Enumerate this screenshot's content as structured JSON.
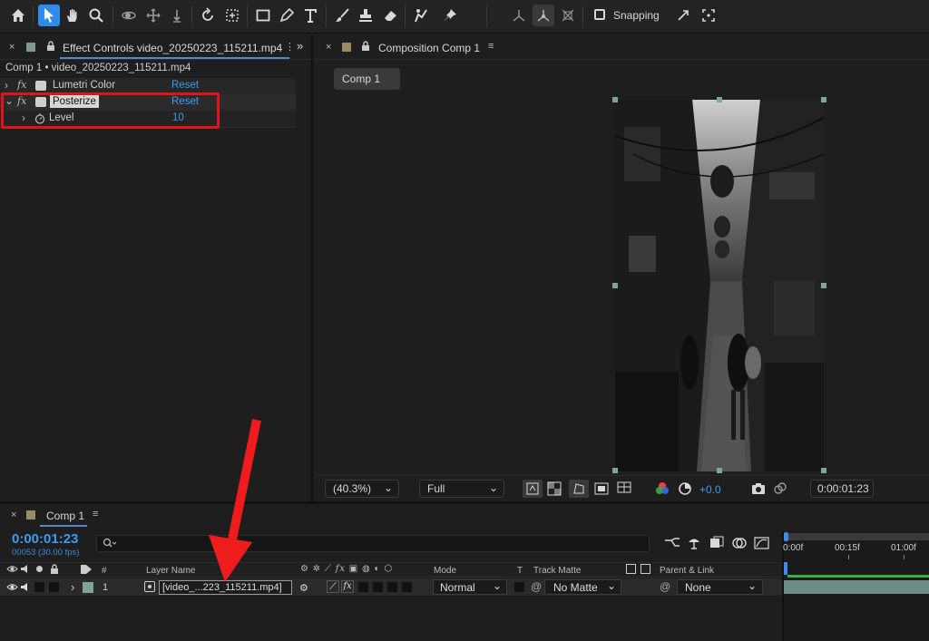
{
  "toolbar": {
    "snapping_label": "Snapping",
    "tools": [
      "home-icon",
      "selection-icon",
      "hand-icon",
      "zoom-icon",
      "orbit-icon",
      "pan-behind-icon",
      "dolly-icon",
      "rotate-icon",
      "track-icon",
      "rectangle-icon",
      "pen-icon",
      "type-icon",
      "brush-icon",
      "clone-stamp-icon",
      "eraser-icon",
      "roto-brush-icon",
      "puppet-pin-icon"
    ]
  },
  "effect_controls": {
    "tab_title": "Effect Controls video_20250223_115211.mp4",
    "breadcrumb": "Comp 1 • video_20250223_115211.mp4",
    "effects": [
      {
        "name": "Lumetri Color",
        "reset": "Reset"
      },
      {
        "name": "Posterize",
        "reset": "Reset"
      }
    ],
    "level_label": "Level",
    "level_value": "10",
    "highlight_color": "#e0141b"
  },
  "composition": {
    "tab_title": "Composition Comp 1",
    "comp_tab": "Comp 1",
    "zoom": "(40.3%)",
    "resolution": "Full",
    "exposure": "+0.0",
    "timecode": "0:00:01:23"
  },
  "timeline": {
    "tab_title": "Comp 1",
    "timecode": "0:00:01:23",
    "frames": "00053 (30.00 fps)",
    "search_placeholder": "",
    "col_num": "#",
    "col_layer_name": "Layer Name",
    "col_mode": "Mode",
    "col_t": "T",
    "col_track_matte": "Track Matte",
    "col_parent": "Parent & Link",
    "ruler": [
      "0:00f",
      "00:15f",
      "01:00f"
    ],
    "layer": {
      "number": "1",
      "name": "[video_...223_115211.mp4]",
      "mode": "Normal",
      "matte": "No Matte",
      "parent": "None"
    },
    "arrow_color": "#ee1c1c"
  }
}
